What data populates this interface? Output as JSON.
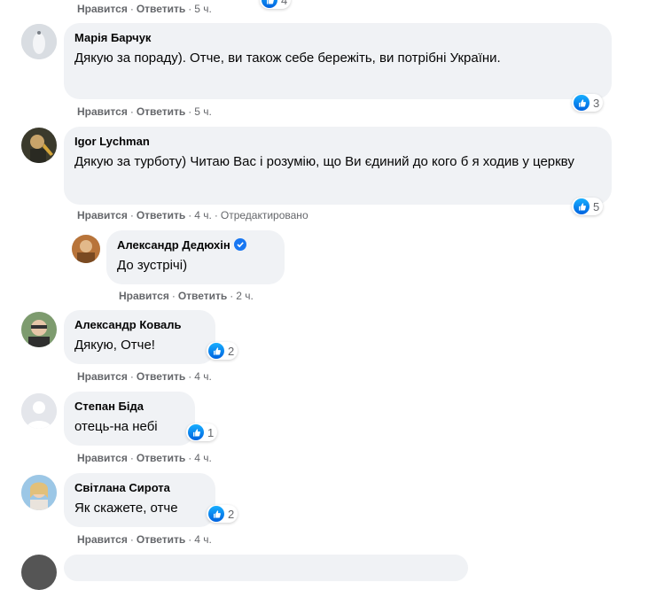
{
  "actions": {
    "like": "Нравится",
    "reply": "Ответить",
    "dot": "·"
  },
  "top": {
    "time": "5 ч.",
    "reactions": "4"
  },
  "comments": [
    {
      "author": "Марія Барчук",
      "text": "Дякую за пораду). Отче, ви також себе бережіть, ви потрібні України.",
      "time": "5 ч.",
      "reactions": "3"
    },
    {
      "author": "Igor Lychman",
      "text": "Дякую за турботу) Читаю Вас і розумію, що Ви єдиний до кого б я ходив у церкву",
      "time": "4 ч.",
      "edited": "Отредактировано",
      "reactions": "5"
    },
    {
      "author": "Александр Дедюхін",
      "text": "До зустрічі)",
      "time": "2 ч."
    },
    {
      "author": "Александр Коваль",
      "text": "Дякую, Отче!",
      "time": "4 ч.",
      "reactions": "2"
    },
    {
      "author": "Степан Біда",
      "text": "отець-на небі",
      "time": "4 ч.",
      "reactions": "1"
    },
    {
      "author": "Світлана Сирота",
      "text": "Як скажете, отче",
      "time": "4 ч.",
      "reactions": "2"
    }
  ]
}
